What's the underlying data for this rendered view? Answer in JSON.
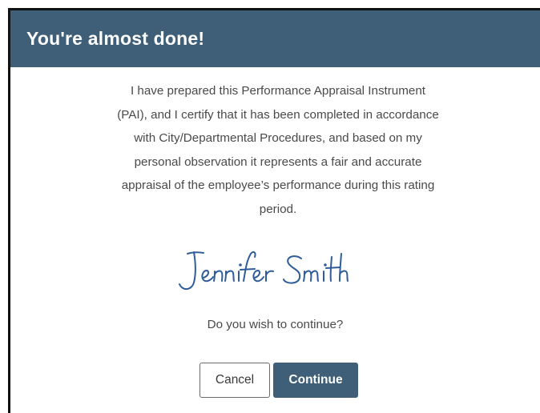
{
  "dialog": {
    "title": "You're almost done!",
    "certification_lines": [
      "I have prepared this Performance Appraisal Instrument",
      "(PAI), and I certify that it has been completed in accordance",
      "with City/Departmental Procedures, and based on my",
      "personal observation it represents a fair and accurate",
      "appraisal of the employee’s performance during this rating",
      "period."
    ],
    "signature_name": "Jennifer Smith",
    "question": "Do you wish to continue?",
    "buttons": {
      "cancel": "Cancel",
      "continue": "Continue"
    }
  },
  "colors": {
    "header_bg": "#3e5f77",
    "signature_ink": "#2f5d9a"
  }
}
